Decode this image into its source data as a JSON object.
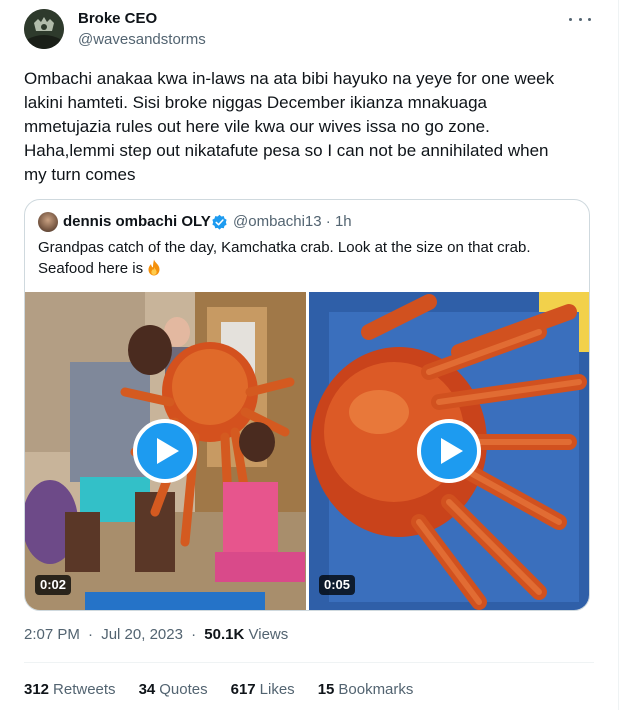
{
  "author": {
    "name": "Broke CEO",
    "handle": "@wavesandstorms",
    "avatar_icon": "profile-avatar"
  },
  "tweet_text": "Ombachi anakaa kwa in-laws na ata bibi hayuko na yeye for one week\nlakini hamteti. Sisi broke niggas December ikianza mnakuagа\nmmetujazia rules out here vile kwa our wives issa no go zone.\nHaha,lemmi step out nikatafute pesa so I can not be annihilated when\nmy turn comes",
  "quoted": {
    "name": "dennis ombachi OLY",
    "handle": "@ombachi13 · 1h",
    "verified_icon": "verified-badge-icon",
    "text": "Grandpas catch of the day, Kamchatka crab. Look at the size on that crab.\nSeafood here is",
    "emoji": "fire-emoji-icon",
    "videos": [
      {
        "duration": "0:02"
      },
      {
        "duration": "0:05"
      }
    ]
  },
  "meta": {
    "time": "2:07 PM",
    "date": "Jul 20, 2023",
    "views_count": "50.1K",
    "views_label": "Views"
  },
  "stats": {
    "retweets_count": "312",
    "retweets_label": "Retweets",
    "quotes_count": "34",
    "quotes_label": "Quotes",
    "likes_count": "617",
    "likes_label": "Likes",
    "bookmarks_count": "15",
    "bookmarks_label": "Bookmarks"
  },
  "colors": {
    "accent": "#1d9bf0",
    "text": "#0f1419",
    "secondary": "#536471",
    "border": "#cfd9de"
  }
}
